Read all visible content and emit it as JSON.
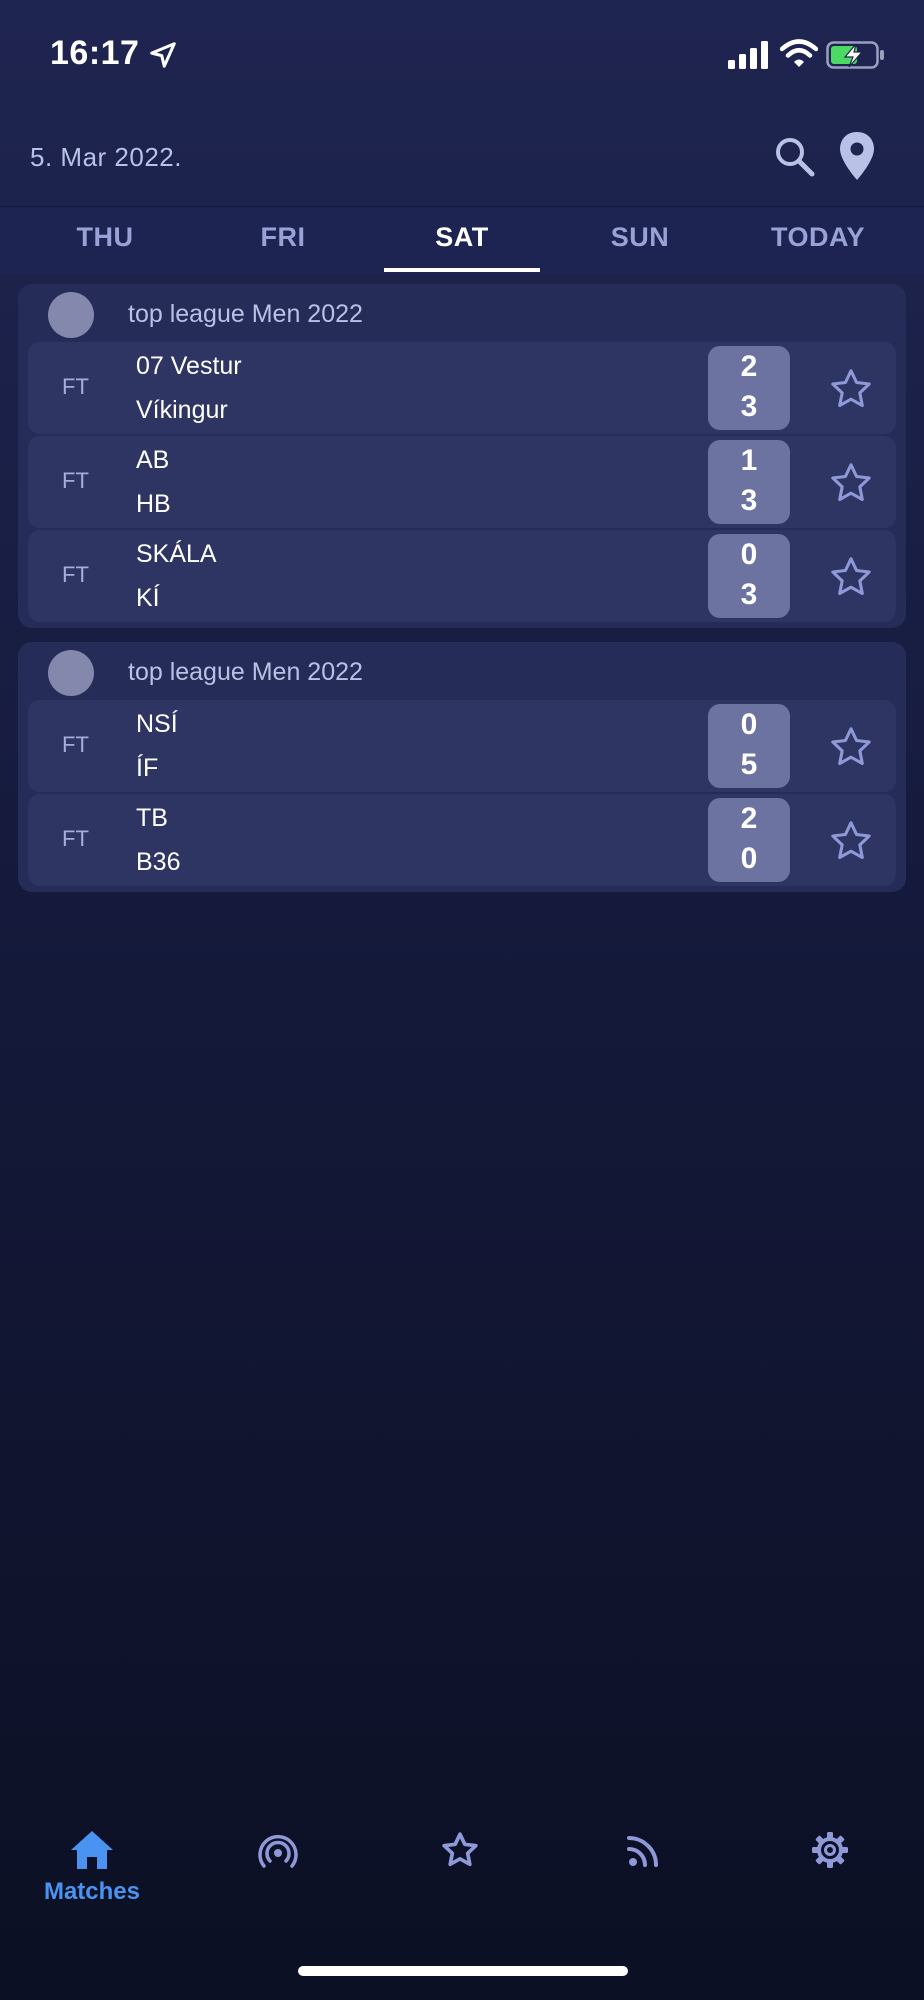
{
  "status_bar": {
    "time": "16:17",
    "icons": [
      "location-arrow-icon",
      "cellular-signal-icon",
      "wifi-icon",
      "battery-charging-icon"
    ],
    "battery_color": "#4cd964"
  },
  "header": {
    "date": "5. Mar 2022.",
    "icons": [
      "search-icon",
      "location-pin-icon"
    ]
  },
  "day_tabs": {
    "items": [
      {
        "label": "THU",
        "active": false
      },
      {
        "label": "FRI",
        "active": false
      },
      {
        "label": "SAT",
        "active": true
      },
      {
        "label": "SUN",
        "active": false
      },
      {
        "label": "TODAY",
        "active": false
      }
    ]
  },
  "leagues": [
    {
      "name": "top league Men 2022",
      "matches": [
        {
          "status": "FT",
          "home": "07 Vestur",
          "away": "Víkingur",
          "home_score": "2",
          "away_score": "3"
        },
        {
          "status": "FT",
          "home": "AB",
          "away": "HB",
          "home_score": "1",
          "away_score": "3"
        },
        {
          "status": "FT",
          "home": "SKÁLA",
          "away": "KÍ",
          "home_score": "0",
          "away_score": "3"
        }
      ]
    },
    {
      "name": "top league Men 2022",
      "matches": [
        {
          "status": "FT",
          "home": "NSÍ",
          "away": "ÍF",
          "home_score": "0",
          "away_score": "5"
        },
        {
          "status": "FT",
          "home": "TB",
          "away": "B36",
          "home_score": "2",
          "away_score": "0"
        }
      ]
    }
  ],
  "bottom_nav": {
    "items": [
      {
        "icon": "home-icon",
        "label": "Matches",
        "active": true
      },
      {
        "icon": "live-broadcast-icon",
        "label": "",
        "active": false
      },
      {
        "icon": "star-icon",
        "label": "",
        "active": false
      },
      {
        "icon": "rss-feed-icon",
        "label": "",
        "active": false
      },
      {
        "icon": "gear-icon",
        "label": "",
        "active": false
      }
    ],
    "active_color": "#4b93f0",
    "inactive_color": "#8f99d8"
  }
}
